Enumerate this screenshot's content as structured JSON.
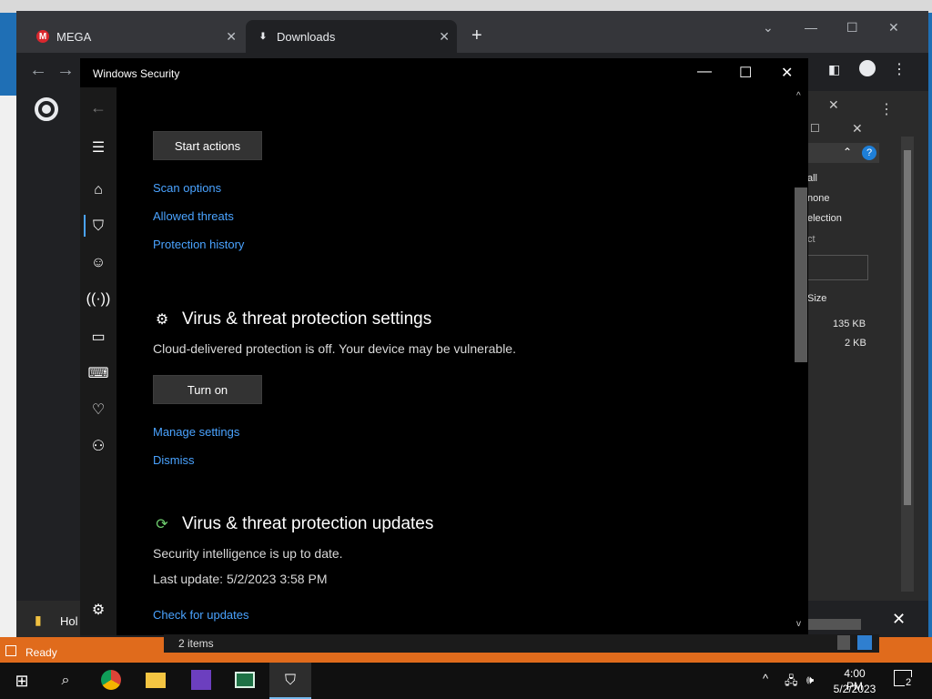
{
  "chrome": {
    "tabs": [
      {
        "label": "MEGA",
        "icon": "mega-icon"
      },
      {
        "label": "Downloads",
        "icon": "download-icon"
      }
    ],
    "new_tab_label": "+"
  },
  "windows_security": {
    "title": "Windows Security",
    "start_actions_label": "Start actions",
    "links_top": [
      "Scan options",
      "Allowed threats",
      "Protection history"
    ],
    "settings": {
      "heading": "Virus & threat protection settings",
      "description": "Cloud-delivered protection is off. Your device may be vulnerable.",
      "turn_on_label": "Turn on",
      "manage_label": "Manage settings",
      "dismiss_label": "Dismiss"
    },
    "updates": {
      "heading": "Virus & threat protection updates",
      "status": "Security intelligence is up to date.",
      "last_update": "Last update: 5/2/2023 3:58 PM",
      "check_label": "Check for updates"
    }
  },
  "background_app": {
    "menu_items": [
      "all",
      "none",
      "election",
      "ct"
    ],
    "size_header": "Size",
    "sizes": [
      "135 KB",
      "2 KB"
    ]
  },
  "status": {
    "ready": "Ready",
    "items": "2 items",
    "left_fragment": "Hol"
  },
  "taskbar": {
    "time": "4:00 PM",
    "date": "5/2/2023",
    "notification_count": "2"
  },
  "colors": {
    "accent": "#4aa3ff",
    "statusbar": "#e06b1c",
    "background": "#000000"
  }
}
